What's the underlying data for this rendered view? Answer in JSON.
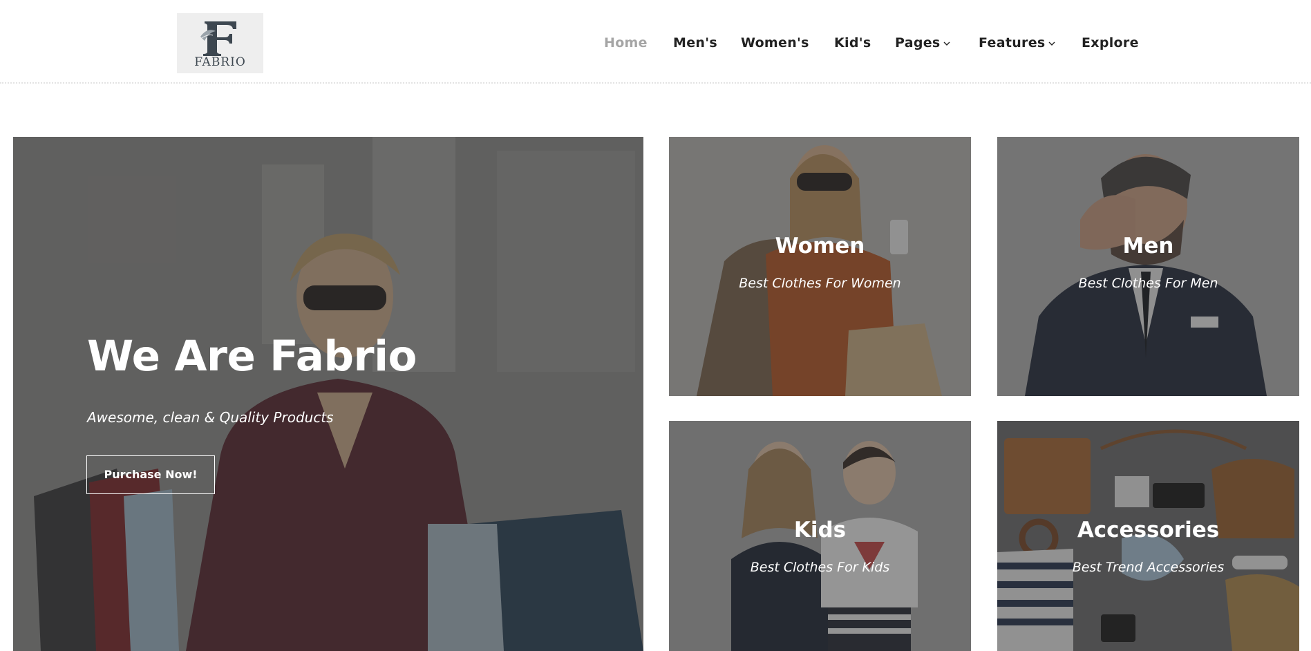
{
  "logo": {
    "text": "FABRIO",
    "letter": "F"
  },
  "nav": {
    "items": [
      {
        "label": "Home",
        "active": true
      },
      {
        "label": "Men's"
      },
      {
        "label": "Women's"
      },
      {
        "label": "Kid's"
      },
      {
        "label": "Pages",
        "dropdown": true
      },
      {
        "label": "Features",
        "dropdown": true
      },
      {
        "label": "Explore"
      }
    ]
  },
  "hero": {
    "title": "We Are Fabrio",
    "subtitle": "Awesome, clean & Quality Products",
    "button_label": "Purchase Now!"
  },
  "categories": [
    {
      "title": "Women",
      "subtitle": "Best Clothes For Women"
    },
    {
      "title": "Men",
      "subtitle": "Best Clothes For Men"
    },
    {
      "title": "Kids",
      "subtitle": "Best Clothes For Kids"
    },
    {
      "title": "Accessories",
      "subtitle": "Best Trend Accessories"
    }
  ],
  "colors": {
    "text_dark": "#222222",
    "nav_active": "#a5a5a5",
    "overlay": "#4a4a4a",
    "white": "#ffffff"
  }
}
